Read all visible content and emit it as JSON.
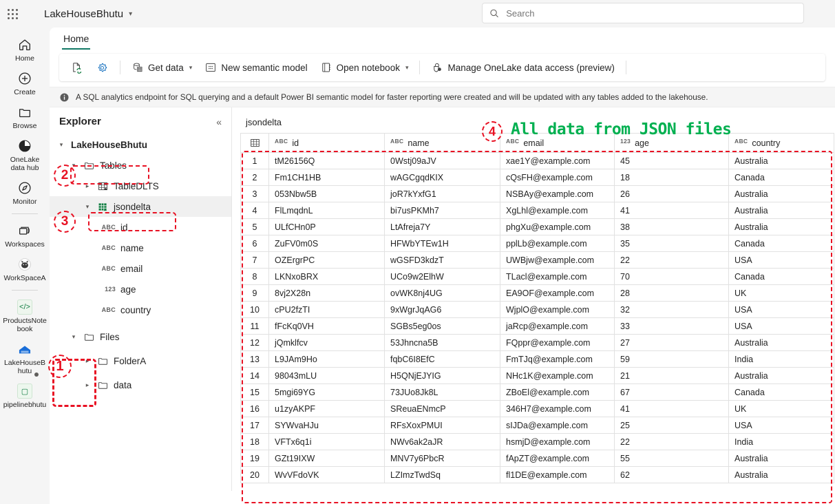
{
  "topbar": {
    "waffle_label": "app-launcher",
    "workspace_name": "LakeHouseBhutu",
    "search_placeholder": "Search"
  },
  "rail": {
    "items": [
      {
        "label": "Home",
        "icon": "home-icon"
      },
      {
        "label": "Create",
        "icon": "plus-circle-icon"
      },
      {
        "label": "Browse",
        "icon": "folder-icon"
      },
      {
        "label": "OneLake data hub",
        "icon": "onelake-icon"
      },
      {
        "label": "Monitor",
        "icon": "monitor-icon"
      },
      {
        "label": "Workspaces",
        "icon": "workspaces-icon"
      },
      {
        "label": "WorkSpaceA",
        "icon": "workspace-avatar-icon"
      },
      {
        "label": "ProductsNotebook",
        "icon": "notebook-code-icon"
      },
      {
        "label": "LakeHouseBhutu",
        "icon": "lakehouse-icon"
      },
      {
        "label": "pipelinebhutu",
        "icon": "pipeline-icon"
      }
    ]
  },
  "tabs": [
    {
      "label": "Home",
      "active": true
    }
  ],
  "toolbar": {
    "refresh_icon": "refresh-page-icon",
    "settings_icon": "gear-icon",
    "get_data": "Get data",
    "new_semantic_model": "New semantic model",
    "open_notebook": "Open notebook",
    "manage_onelake": "Manage OneLake data access (preview)"
  },
  "infobar": {
    "icon": "info-icon",
    "message": "A SQL analytics endpoint for SQL querying and a default Power BI semantic model for faster reporting were created and will be updated with any tables added to the lakehouse."
  },
  "explorer": {
    "title": "Explorer",
    "collapse_icon": "collapse-panel-icon",
    "root": "LakeHouseBhutu",
    "tables_label": "Tables",
    "tables": [
      {
        "label": "TableDLTS",
        "expanded": false
      },
      {
        "label": "jsondelta",
        "expanded": true,
        "selected": true
      }
    ],
    "columns": [
      {
        "type": "ABC",
        "label": "id"
      },
      {
        "type": "ABC",
        "label": "name"
      },
      {
        "type": "ABC",
        "label": "email"
      },
      {
        "type": "123",
        "label": "age"
      },
      {
        "type": "ABC",
        "label": "country"
      }
    ],
    "files_label": "Files",
    "files": [
      {
        "label": "FolderA"
      },
      {
        "label": "data"
      }
    ]
  },
  "table": {
    "title": "jsondelta",
    "grid_icon": "table-grid-icon",
    "columns": [
      {
        "type": "ABC",
        "label": "id"
      },
      {
        "type": "ABC",
        "label": "name"
      },
      {
        "type": "ABC",
        "label": "email"
      },
      {
        "type": "123",
        "label": "age"
      },
      {
        "type": "ABC",
        "label": "country"
      }
    ],
    "rows": [
      {
        "n": "1",
        "id": "tM26156Q",
        "name": "0Wstj09aJV",
        "email": "xae1Y@example.com",
        "age": "45",
        "country": "Australia"
      },
      {
        "n": "2",
        "id": "Fm1CH1HB",
        "name": "wAGCgqdKIX",
        "email": "cQsFH@example.com",
        "age": "18",
        "country": "Canada"
      },
      {
        "n": "3",
        "id": "053Nbw5B",
        "name": "joR7kYxfG1",
        "email": "NSBAy@example.com",
        "age": "26",
        "country": "Australia"
      },
      {
        "n": "4",
        "id": "FlLmqdnL",
        "name": "bi7usPKMh7",
        "email": "XgLhl@example.com",
        "age": "41",
        "country": "Australia"
      },
      {
        "n": "5",
        "id": "ULfCHn0P",
        "name": "LtAfreja7Y",
        "email": "phgXu@example.com",
        "age": "38",
        "country": "Australia"
      },
      {
        "n": "6",
        "id": "ZuFV0m0S",
        "name": "HFWbYTEw1H",
        "email": "pplLb@example.com",
        "age": "35",
        "country": "Canada"
      },
      {
        "n": "7",
        "id": "OZErgrPC",
        "name": "wGSFD3kdzT",
        "email": "UWBjw@example.com",
        "age": "22",
        "country": "USA"
      },
      {
        "n": "8",
        "id": "LKNxoBRX",
        "name": "UCo9w2ElhW",
        "email": "TLacl@example.com",
        "age": "70",
        "country": "Canada"
      },
      {
        "n": "9",
        "id": "8vj2X28n",
        "name": "ovWK8nj4UG",
        "email": "EA9OF@example.com",
        "age": "28",
        "country": "UK"
      },
      {
        "n": "10",
        "id": "cPU2fzTI",
        "name": "9xWgrJqAG6",
        "email": "WjplO@example.com",
        "age": "32",
        "country": "USA"
      },
      {
        "n": "11",
        "id": "fFcKq0VH",
        "name": "SGBs5eg0os",
        "email": "jaRcp@example.com",
        "age": "33",
        "country": "USA"
      },
      {
        "n": "12",
        "id": "jQmklfcv",
        "name": "53Jhncna5B",
        "email": "FQppr@example.com",
        "age": "27",
        "country": "Australia"
      },
      {
        "n": "13",
        "id": "L9JAm9Ho",
        "name": "fqbC6I8EfC",
        "email": "FmTJq@example.com",
        "age": "59",
        "country": "India"
      },
      {
        "n": "14",
        "id": "98043mLU",
        "name": "H5QNjEJYIG",
        "email": "NHc1K@example.com",
        "age": "21",
        "country": "Australia"
      },
      {
        "n": "15",
        "id": "5mgi69YG",
        "name": "73JUo8Jk8L",
        "email": "ZBoEl@example.com",
        "age": "67",
        "country": "Canada"
      },
      {
        "n": "16",
        "id": "u1zyAKPF",
        "name": "SReuaENmcP",
        "email": "346H7@example.com",
        "age": "41",
        "country": "UK"
      },
      {
        "n": "17",
        "id": "SYWvaHJu",
        "name": "RFsXoxPMUI",
        "email": "sIJDa@example.com",
        "age": "25",
        "country": "USA"
      },
      {
        "n": "18",
        "id": "VFTx6q1i",
        "name": "NWv6ak2aJR",
        "email": "hsmjD@example.com",
        "age": "22",
        "country": "India"
      },
      {
        "n": "19",
        "id": "GZt19IXW",
        "name": "MNV7y6PbcR",
        "email": "fApZT@example.com",
        "age": "55",
        "country": "Australia"
      },
      {
        "n": "20",
        "id": "WvVFdoVK",
        "name": "LZImzTwdSq",
        "email": "fl1DE@example.com",
        "age": "62",
        "country": "Australia"
      }
    ]
  },
  "annotations": {
    "marker_color": "#e81123",
    "note_color": "#00b050",
    "markers": [
      {
        "n": "1"
      },
      {
        "n": "2"
      },
      {
        "n": "3"
      },
      {
        "n": "4"
      }
    ],
    "note_text": "All data from JSON files"
  }
}
